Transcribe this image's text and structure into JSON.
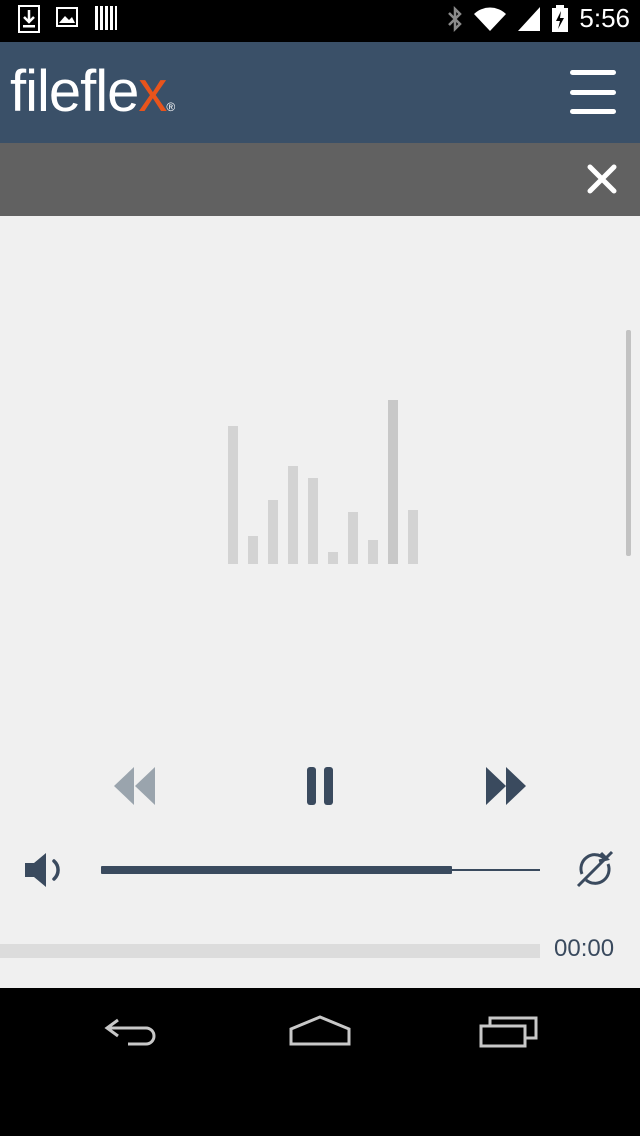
{
  "status_bar": {
    "time": "5:56",
    "left_icons": [
      "download-icon",
      "image-icon",
      "barcode-icon"
    ],
    "right_icons": [
      "bluetooth-icon",
      "wifi-icon",
      "signal-icon",
      "battery-charging-icon"
    ]
  },
  "app_bar": {
    "logo": {
      "part1": "filefle",
      "part2": "x",
      "mark": "®"
    },
    "menu_icon": "hamburger-menu-icon"
  },
  "close_bar": {
    "close_icon": "close-icon"
  },
  "player": {
    "equalizer_icon": "equalizer-bars-icon",
    "controls": {
      "rewind_icon": "rewind-icon",
      "pause_icon": "pause-icon",
      "fast_forward_icon": "fast-forward-icon",
      "volume_icon": "volume-icon",
      "shuffle_icon": "repeat-off-icon"
    },
    "volume_level": 0.8,
    "seek_position": 0.0,
    "time_display": "00:00"
  },
  "colors": {
    "app_bar": "#3a5068",
    "accent": "#e8541c",
    "close_bar": "#616161",
    "content_bg": "#f0f0f0",
    "controls": "#3a4a5e"
  },
  "nav_bar": {
    "icons": [
      "back-icon",
      "home-icon",
      "recents-icon"
    ]
  }
}
